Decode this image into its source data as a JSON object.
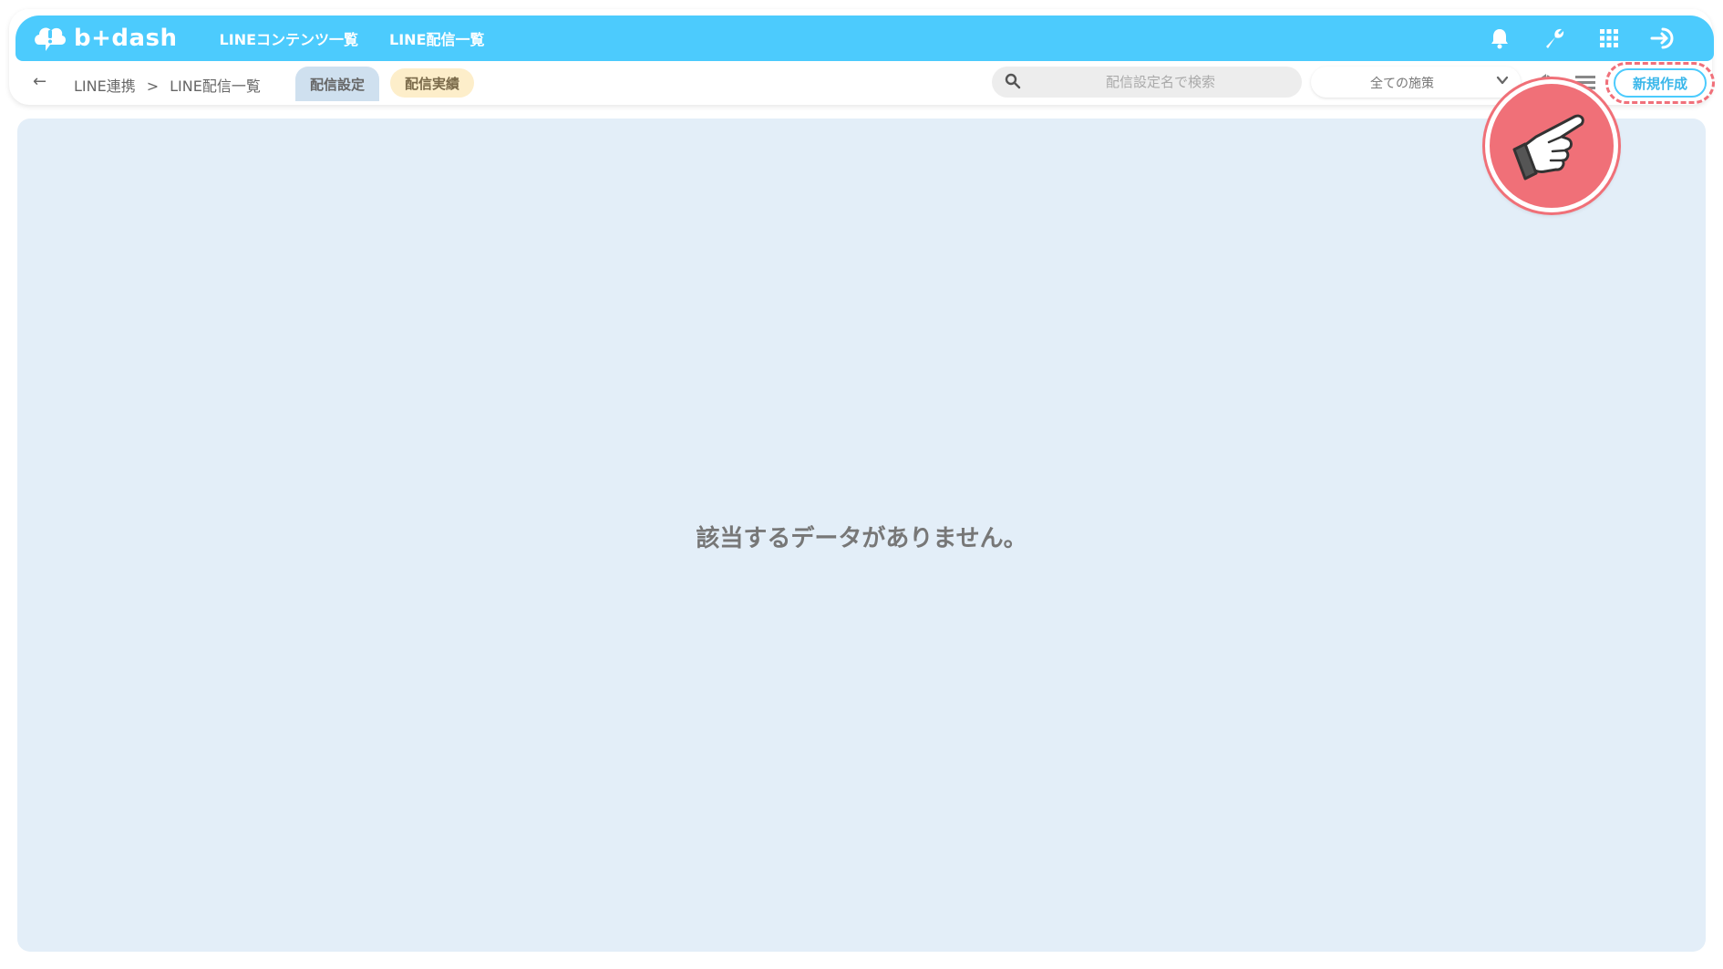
{
  "header": {
    "logo_text": "b+dash",
    "nav": [
      {
        "label": "LINEコンテンツ一覧"
      },
      {
        "label": "LINE配信一覧"
      }
    ],
    "icons": [
      "bell-icon",
      "wrench-icon",
      "grid-apps-icon",
      "logout-icon"
    ]
  },
  "subbar": {
    "breadcrumb": {
      "root": "LINE連携",
      "separator": ">",
      "current": "LINE配信一覧"
    },
    "tabs": [
      {
        "label": "配信設定",
        "active": true
      },
      {
        "label": "配信実績",
        "active": false
      }
    ],
    "search": {
      "placeholder": "配信設定名で検索",
      "value": ""
    },
    "filter": {
      "selected": "全ての施策"
    },
    "new_button": "新規作成"
  },
  "content": {
    "empty_message": "該当するデータがありません。"
  },
  "colors": {
    "brand": "#4ccbfd",
    "content_bg": "#e3eef8",
    "highlight": "#f07078",
    "tab_active": "#cfe0ef",
    "tab_secondary": "#fdeeca"
  }
}
